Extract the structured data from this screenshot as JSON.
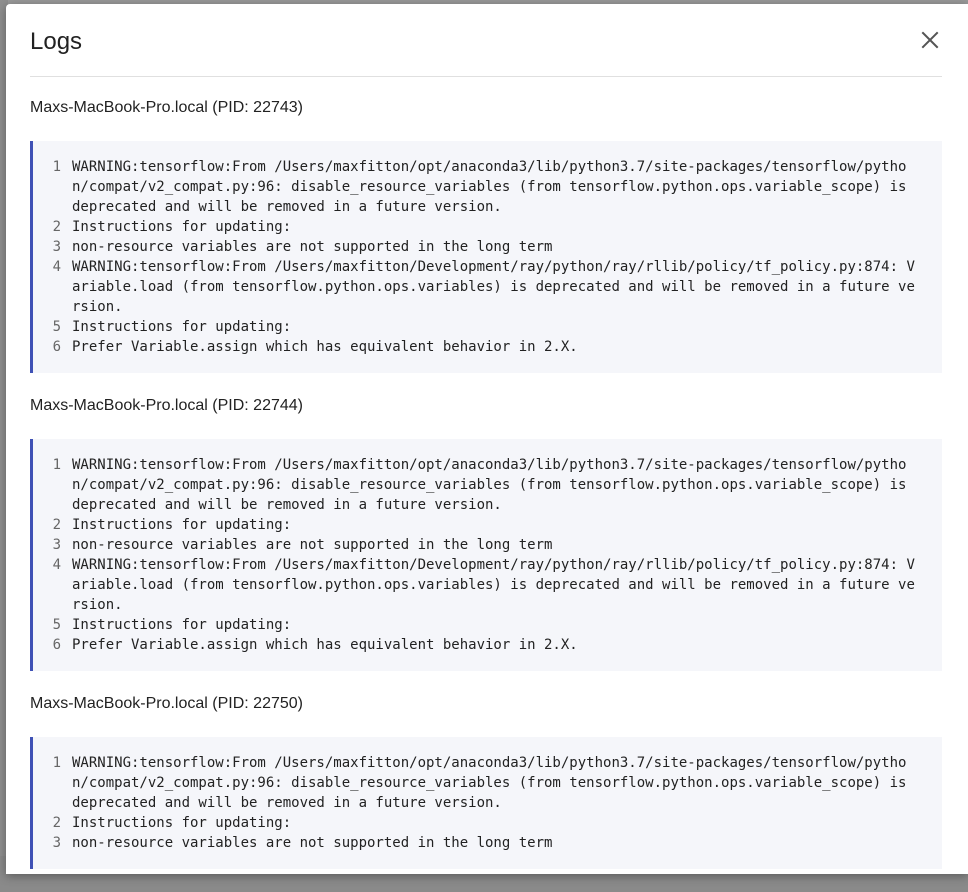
{
  "dialog": {
    "title": "Logs",
    "close_icon": "close-icon"
  },
  "sections": [
    {
      "host": "Maxs-MacBook-Pro.local (PID: 22743)",
      "lines": [
        {
          "n": "1",
          "text": "WARNING:tensorflow:From /Users/maxfitton/opt/anaconda3/lib/python3.7/site-packages/tensorflow/python/compat/v2_compat.py:96: disable_resource_variables (from tensorflow.python.ops.variable_scope) is deprecated and will be removed in a future version."
        },
        {
          "n": "2",
          "text": "Instructions for updating:"
        },
        {
          "n": "3",
          "text": "non-resource variables are not supported in the long term"
        },
        {
          "n": "4",
          "text": "WARNING:tensorflow:From /Users/maxfitton/Development/ray/python/ray/rllib/policy/tf_policy.py:874: Variable.load (from tensorflow.python.ops.variables) is deprecated and will be removed in a future version."
        },
        {
          "n": "5",
          "text": "Instructions for updating:"
        },
        {
          "n": "6",
          "text": "Prefer Variable.assign which has equivalent behavior in 2.X."
        }
      ]
    },
    {
      "host": "Maxs-MacBook-Pro.local (PID: 22744)",
      "lines": [
        {
          "n": "1",
          "text": "WARNING:tensorflow:From /Users/maxfitton/opt/anaconda3/lib/python3.7/site-packages/tensorflow/python/compat/v2_compat.py:96: disable_resource_variables (from tensorflow.python.ops.variable_scope) is deprecated and will be removed in a future version."
        },
        {
          "n": "2",
          "text": "Instructions for updating:"
        },
        {
          "n": "3",
          "text": "non-resource variables are not supported in the long term"
        },
        {
          "n": "4",
          "text": "WARNING:tensorflow:From /Users/maxfitton/Development/ray/python/ray/rllib/policy/tf_policy.py:874: Variable.load (from tensorflow.python.ops.variables) is deprecated and will be removed in a future version."
        },
        {
          "n": "5",
          "text": "Instructions for updating:"
        },
        {
          "n": "6",
          "text": "Prefer Variable.assign which has equivalent behavior in 2.X."
        }
      ]
    },
    {
      "host": "Maxs-MacBook-Pro.local (PID: 22750)",
      "lines": [
        {
          "n": "1",
          "text": "WARNING:tensorflow:From /Users/maxfitton/opt/anaconda3/lib/python3.7/site-packages/tensorflow/python/compat/v2_compat.py:96: disable_resource_variables (from tensorflow.python.ops.variable_scope) is deprecated and will be removed in a future version."
        },
        {
          "n": "2",
          "text": "Instructions for updating:"
        },
        {
          "n": "3",
          "text": "non-resource variables are not supported in the long term"
        }
      ]
    }
  ]
}
